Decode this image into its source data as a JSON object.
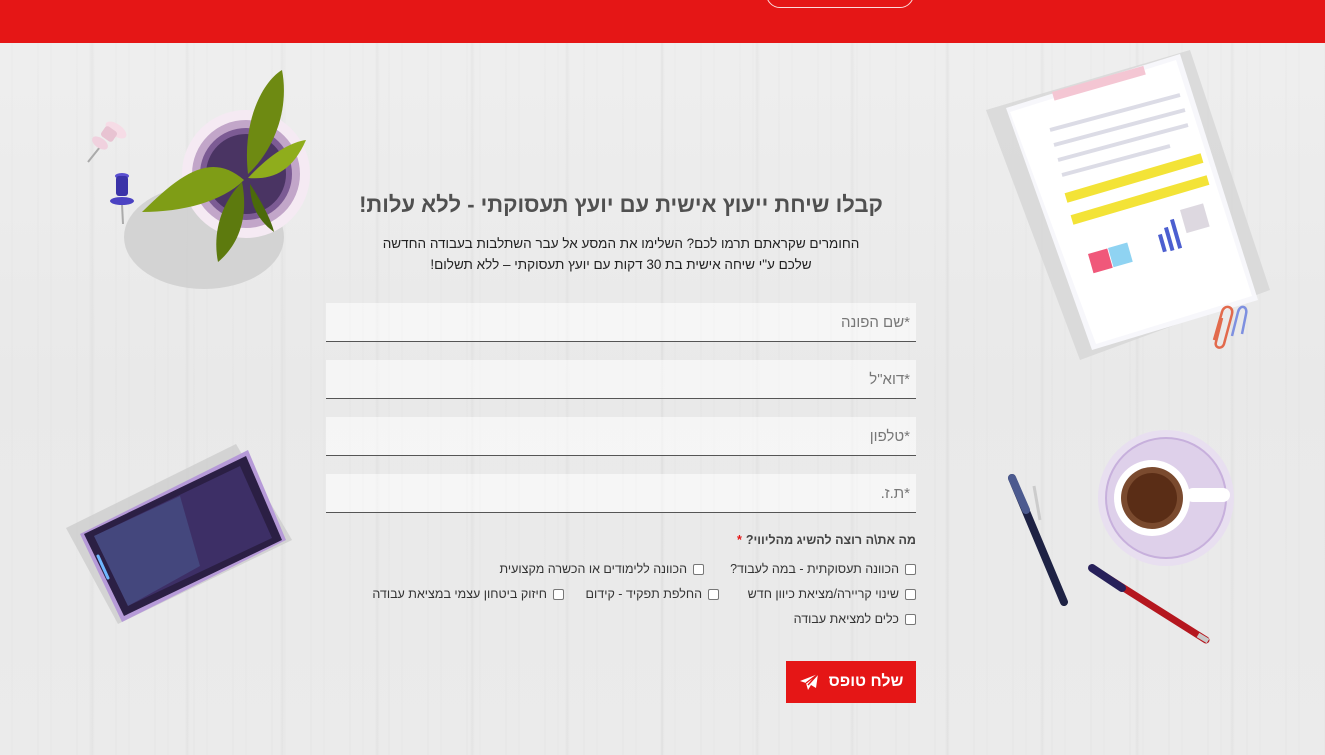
{
  "header": {
    "top_button_label": ""
  },
  "form": {
    "title": "קבלו שיחת ייעוץ אישית עם יועץ תעסוקתי - ללא עלות!",
    "subtitle_line1": "החומרים שקראתם תרמו לכם? השלימו את המסע אל עבר השתלבות בעבודה החדשה",
    "subtitle_line2": "שלכם ע\"י שיחה אישית בת 30 דקות עם יועץ תעסוקתי – ללא תשלום!",
    "fields": [
      {
        "placeholder": "*שם הפונה",
        "value": ""
      },
      {
        "placeholder": "*דוא\"ל",
        "value": ""
      },
      {
        "placeholder": "*טלפון",
        "value": ""
      },
      {
        "placeholder": "*ת.ז.",
        "value": ""
      }
    ],
    "question": "מה את\\ה רוצה להשיג מהליווי?",
    "required_marker": "*",
    "options": [
      "הכוונה תעסוקתית - במה לעבוד?",
      "הכוונה ללימודים או הכשרה מקצועית",
      "שינוי קריירה/מציאת כיוון חדש",
      "החלפת תפקיד - קידום",
      "חיזוק ביטחון עצמי במציאת עבודה",
      "כלים למציאת עבודה"
    ],
    "submit_label": "שלח טופס"
  },
  "colors": {
    "brand_red": "#e51616",
    "background": "#ececec"
  },
  "icons": {
    "submit": "paper-plane-icon"
  }
}
